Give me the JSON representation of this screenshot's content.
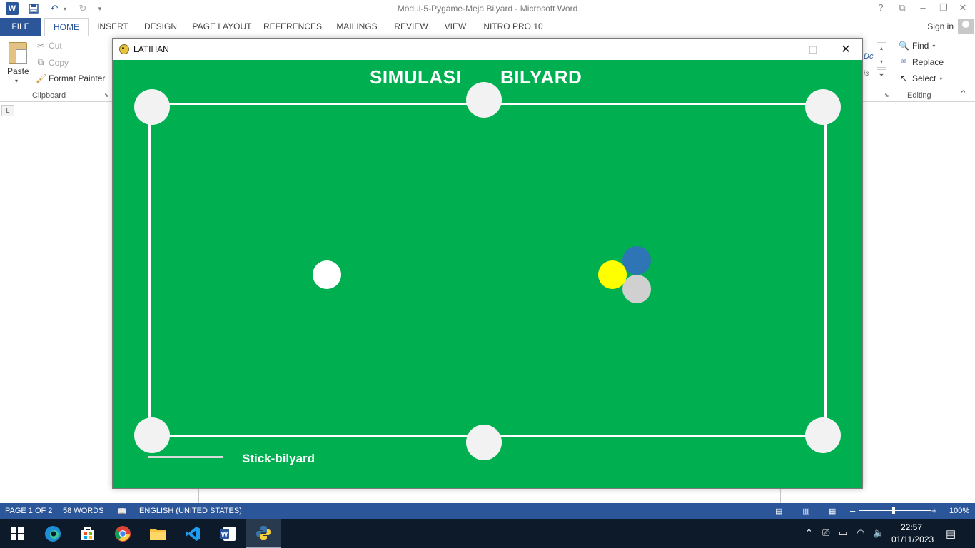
{
  "word": {
    "window_title": "Modul-5-Pygame-Meja Bilyard - Microsoft Word",
    "tabs": [
      "FILE",
      "HOME",
      "INSERT",
      "DESIGN",
      "PAGE LAYOUT",
      "REFERENCES",
      "MAILINGS",
      "REVIEW",
      "VIEW",
      "NITRO PRO 10"
    ],
    "sign_in": "Sign in",
    "clipboard": {
      "paste": "Paste",
      "cut": "Cut",
      "copy": "Copy",
      "format_painter": "Format Painter",
      "group_label": "Clipboard"
    },
    "styles_samples": [
      "Dc",
      "is"
    ],
    "editing": {
      "find": "Find",
      "replace": "Replace",
      "select": "Select",
      "group_label": "Editing"
    },
    "status": {
      "page": "PAGE 1 OF 2",
      "words": "58 WORDS",
      "language": "ENGLISH (UNITED STATES)",
      "zoom": "100%"
    }
  },
  "pygame": {
    "window_title": "LATIHAN",
    "heading_left": "SIMULASI",
    "heading_right": "BILYARD",
    "stick_label": "Stick-bilyard",
    "colors": {
      "table": "#00b050",
      "rail": "#ffffff",
      "pocket": "#f2f2f2",
      "cue_ball": "#ffffff",
      "yellow_ball": "#ffff00",
      "blue_ball": "#2e75b6",
      "grey_ball": "#d0d0d0",
      "stick": "#d9d9d9"
    }
  },
  "taskbar": {
    "time": "22:57",
    "date": "01/11/2023",
    "apps": [
      "start-icon",
      "edge-icon",
      "store-icon",
      "chrome-icon",
      "file-explorer-icon",
      "vscode-icon",
      "word-icon",
      "python-icon"
    ]
  }
}
